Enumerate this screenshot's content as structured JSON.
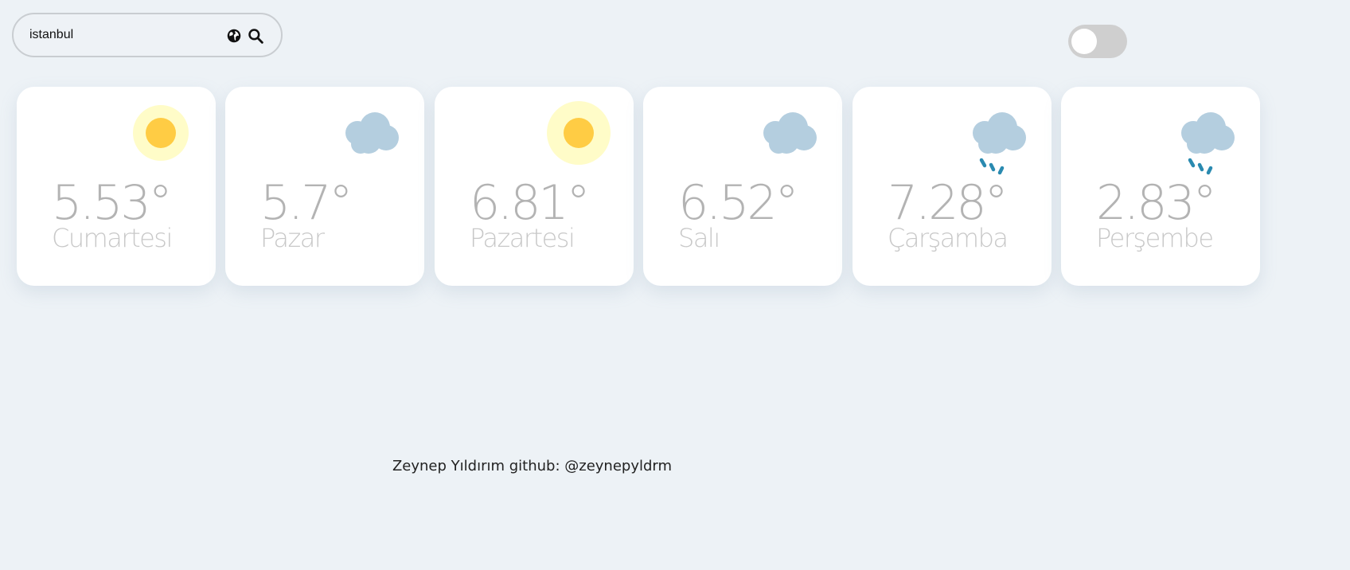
{
  "search": {
    "value": "istanbul",
    "globe_icon": "globe-icon",
    "search_icon": "search-icon"
  },
  "theme_toggle": {
    "state": "off"
  },
  "colors": {
    "background": "#edf2f6",
    "sun_core": "#ffcc44",
    "sun_glow": "#fffcc8",
    "cloud": "#b4cedf",
    "rain": "#2a8ab0",
    "temp_text": "#b3b3b3",
    "day_text": "#c8c8c8"
  },
  "forecast": [
    {
      "temp": "5.53°",
      "day": "Cumartesi",
      "icon": "sun-icon"
    },
    {
      "temp": "5.7°",
      "day": "Pazar",
      "icon": "cloud-icon"
    },
    {
      "temp": "6.81°",
      "day": "Pazartesi",
      "icon": "sun-icon"
    },
    {
      "temp": "6.52°",
      "day": "Salı",
      "icon": "cloud-icon"
    },
    {
      "temp": "7.28°",
      "day": "Çarşamba",
      "icon": "rain-icon"
    },
    {
      "temp": "2.83°",
      "day": "Perşembe",
      "icon": "rain-icon"
    }
  ],
  "footer": {
    "text": "Zeynep Yıldırım github: @zeynepyldrm"
  }
}
